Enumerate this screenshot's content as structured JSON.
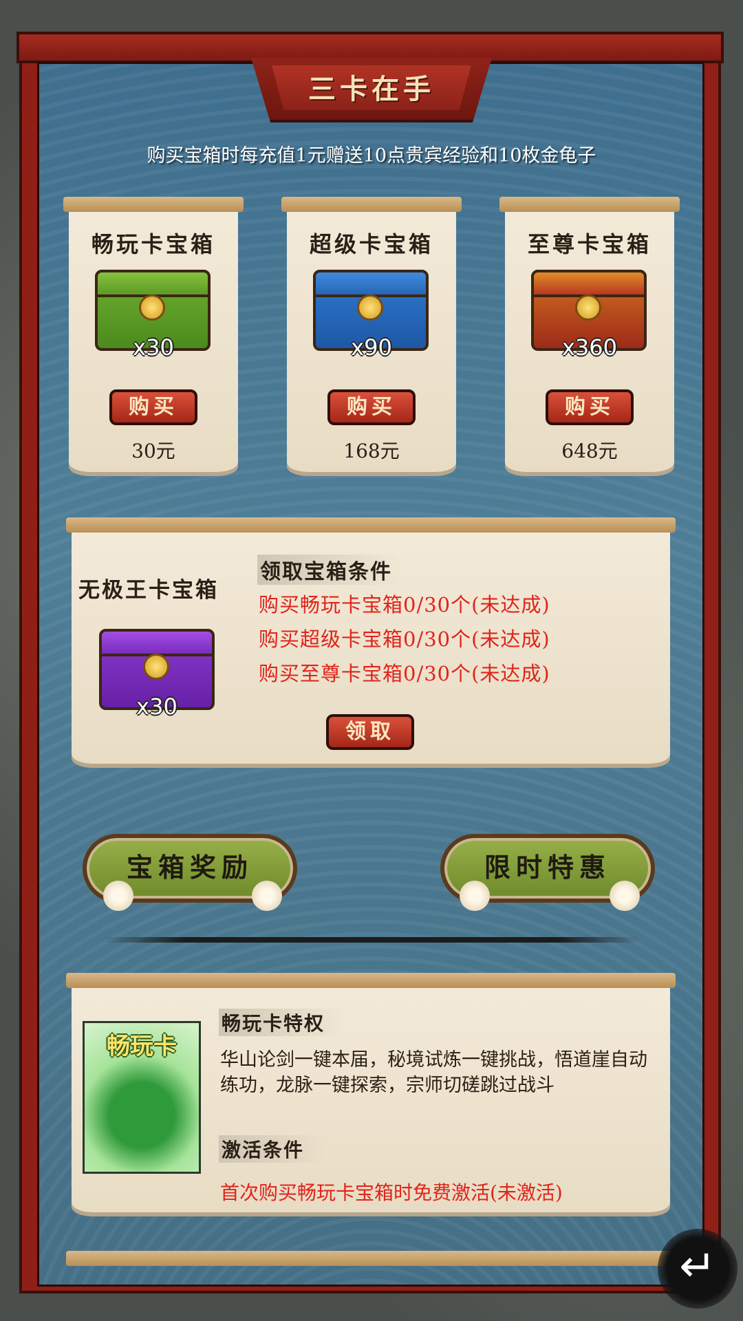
{
  "header": {
    "title": "三卡在手",
    "subtitle": "购买宝箱时每充值1元赠送10点贵宾经验和10枚金龟子"
  },
  "cards": [
    {
      "title": "畅玩卡宝箱",
      "qty": "x30",
      "buy_label": "购买",
      "price": "30元",
      "chest_color": "green"
    },
    {
      "title": "超级卡宝箱",
      "qty": "x90",
      "buy_label": "购买",
      "price": "168元",
      "chest_color": "blue"
    },
    {
      "title": "至尊卡宝箱",
      "qty": "x360",
      "buy_label": "购买",
      "price": "648元",
      "chest_color": "red"
    }
  ],
  "condition": {
    "chest_name": "无极王卡宝箱",
    "qty": "x30",
    "heading": "领取宝箱条件",
    "lines": [
      "购买畅玩卡宝箱0/30个(未达成)",
      "购买超级卡宝箱0/30个(未达成)",
      "购买至尊卡宝箱0/30个(未达成)"
    ],
    "claim_label": "领取"
  },
  "actions": {
    "chest_reward": "宝箱奖励",
    "limited_offer": "限时特惠"
  },
  "privilege": {
    "card_title": "畅玩卡",
    "heading": "畅玩卡特权",
    "description": "华山论剑一键本届，秘境试炼一键挑战，悟道崖自动练功，龙脉一键探索，宗师切磋跳过战斗",
    "activate_heading": "激活条件",
    "activate_text": "首次购买畅玩卡宝箱时免费激活(未激活)"
  },
  "colors": {
    "frame_red": "#8f2018",
    "panel_blue": "#4f7e97",
    "parchment": "#f3ead9",
    "alert_red": "#e0241b",
    "button_red": "#c23a28"
  },
  "icons": {
    "back": "return-arrow-icon"
  }
}
